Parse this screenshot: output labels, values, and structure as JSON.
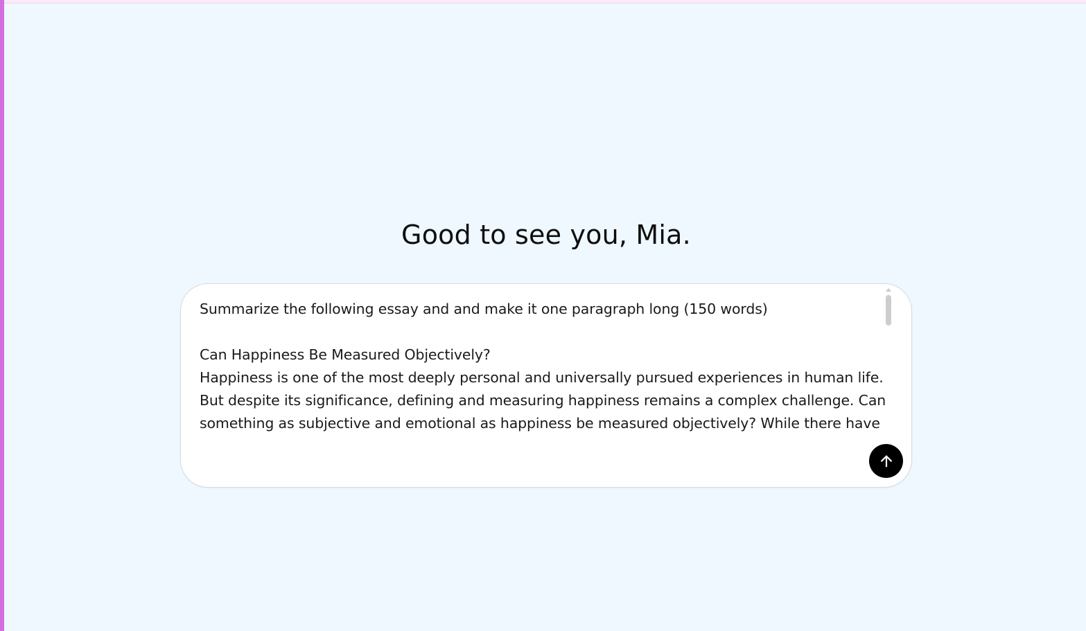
{
  "greeting": "Good to see you, Mia.",
  "composer": {
    "text": "Summarize the following essay and and make it one paragraph long (150 words)\n\nCan Happiness Be Measured Objectively?\nHappiness is one of the most deeply personal and universally pursued experiences in human life. But despite its significance, defining and measuring happiness remains a complex challenge. Can something as subjective and emotional as happiness be measured objectively? While there have been",
    "send_icon": "arrow-up-icon"
  },
  "colors": {
    "background": "#eff7ff",
    "accent": "#d36ede",
    "send_button": "#000000"
  }
}
